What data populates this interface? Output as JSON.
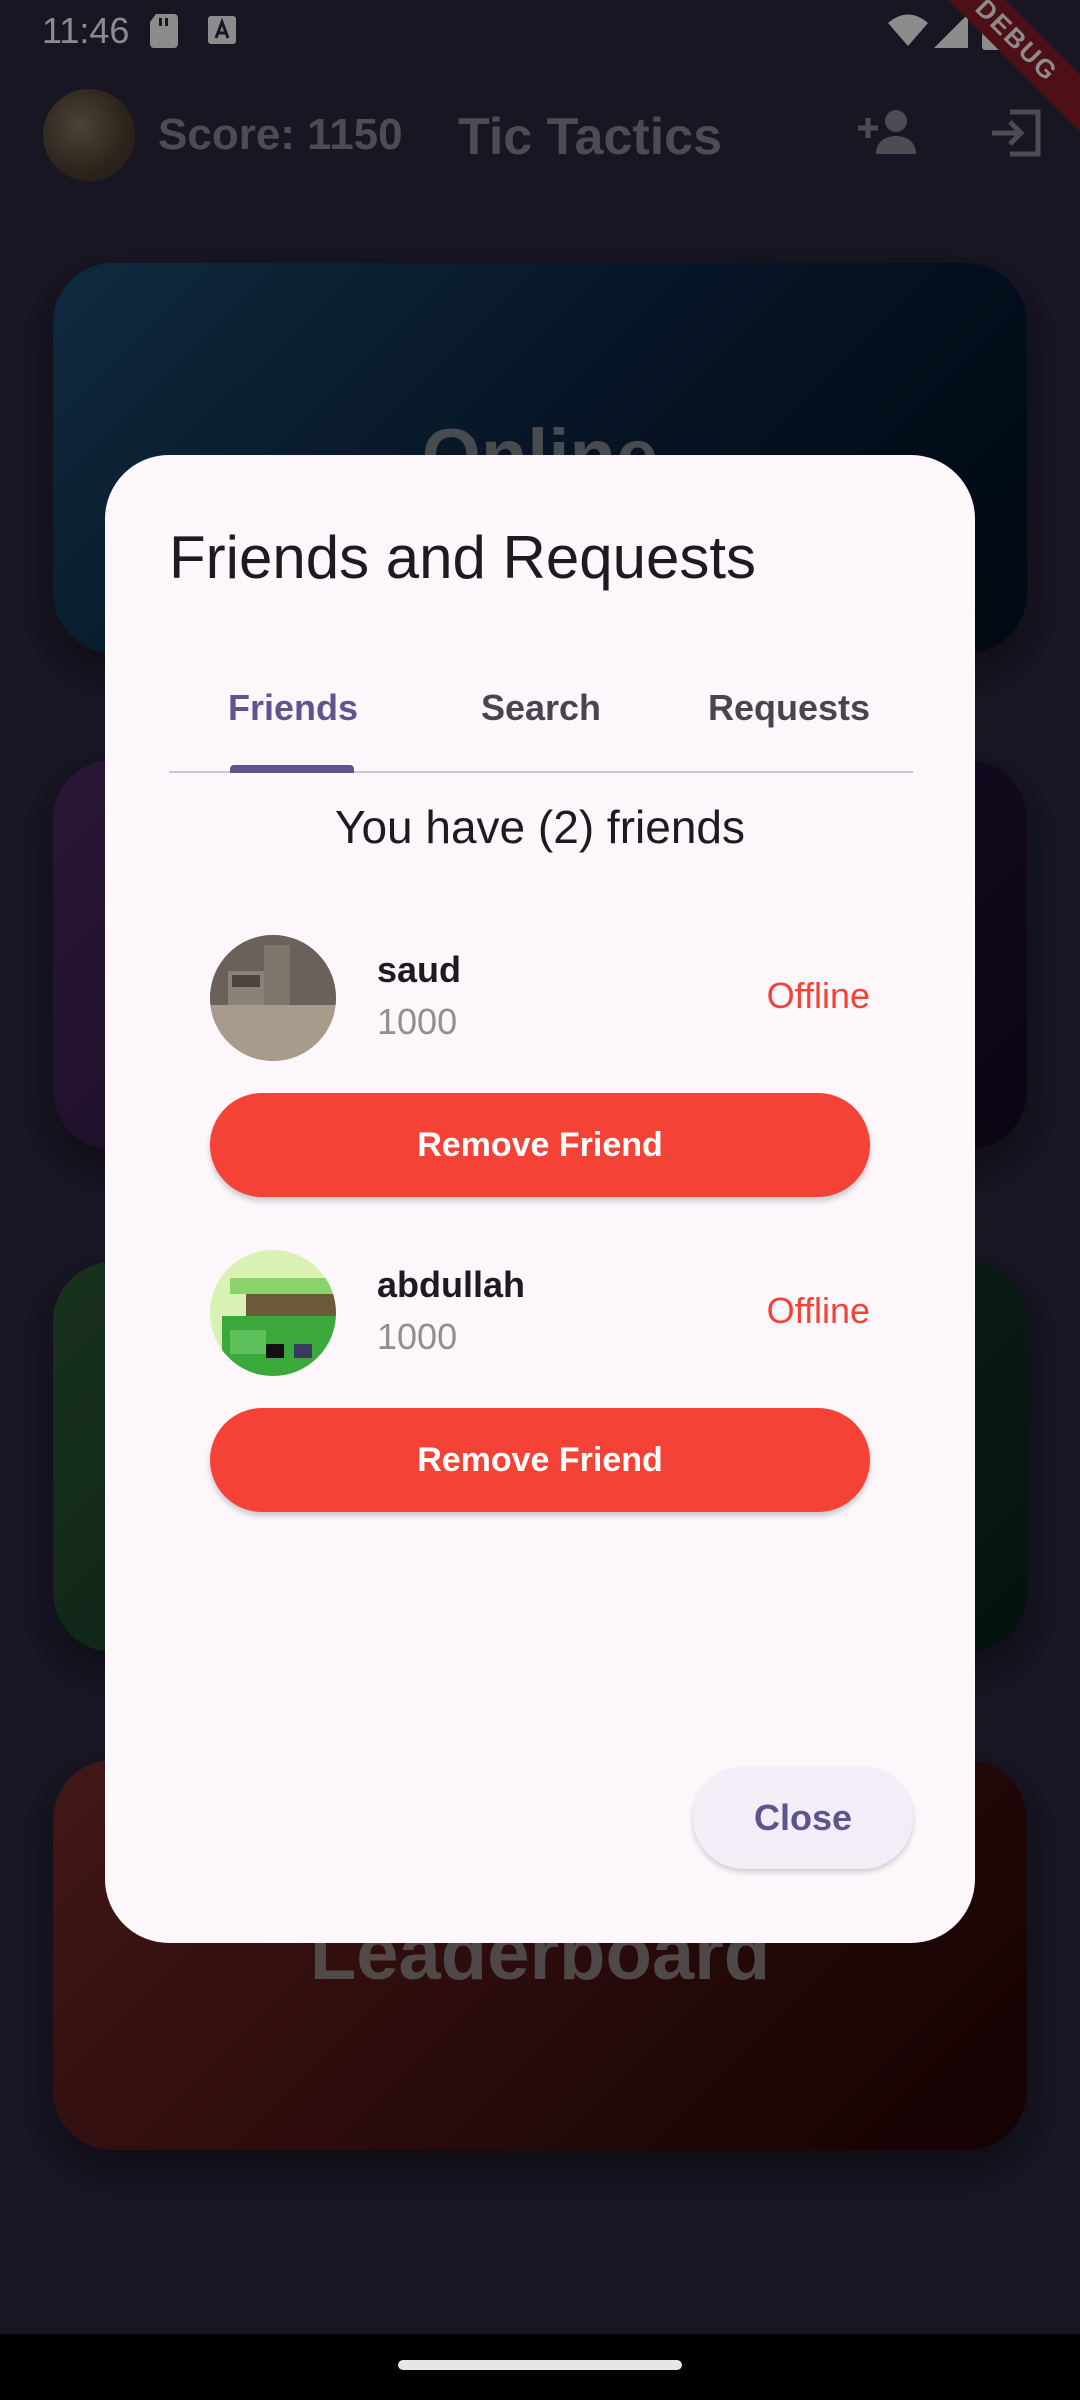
{
  "status_bar": {
    "time": "11:46",
    "debug_label": "DEBUG"
  },
  "app_bar": {
    "score": "Score: 1150",
    "title": "Tic Tactics",
    "add_friend_icon": "person-add-icon",
    "logout_icon": "logout-icon"
  },
  "background_cards": {
    "online": "Online",
    "leaderboard": "Leaderboard"
  },
  "dialog": {
    "title": "Friends and Requests",
    "tabs": [
      {
        "label": "Friends",
        "active": true
      },
      {
        "label": "Search",
        "active": false
      },
      {
        "label": "Requests",
        "active": false
      }
    ],
    "friends_count_text": "You have (2) friends",
    "friends": [
      {
        "name": "saud",
        "score": "1000",
        "status": "Offline",
        "remove_label": "Remove Friend"
      },
      {
        "name": "abdullah",
        "score": "1000",
        "status": "Offline",
        "remove_label": "Remove Friend"
      }
    ],
    "close_label": "Close"
  },
  "colors": {
    "accent": "#5e548e",
    "danger": "#f44336",
    "dialog_bg": "#fdf7fc",
    "page_bg": "#2e2943"
  }
}
